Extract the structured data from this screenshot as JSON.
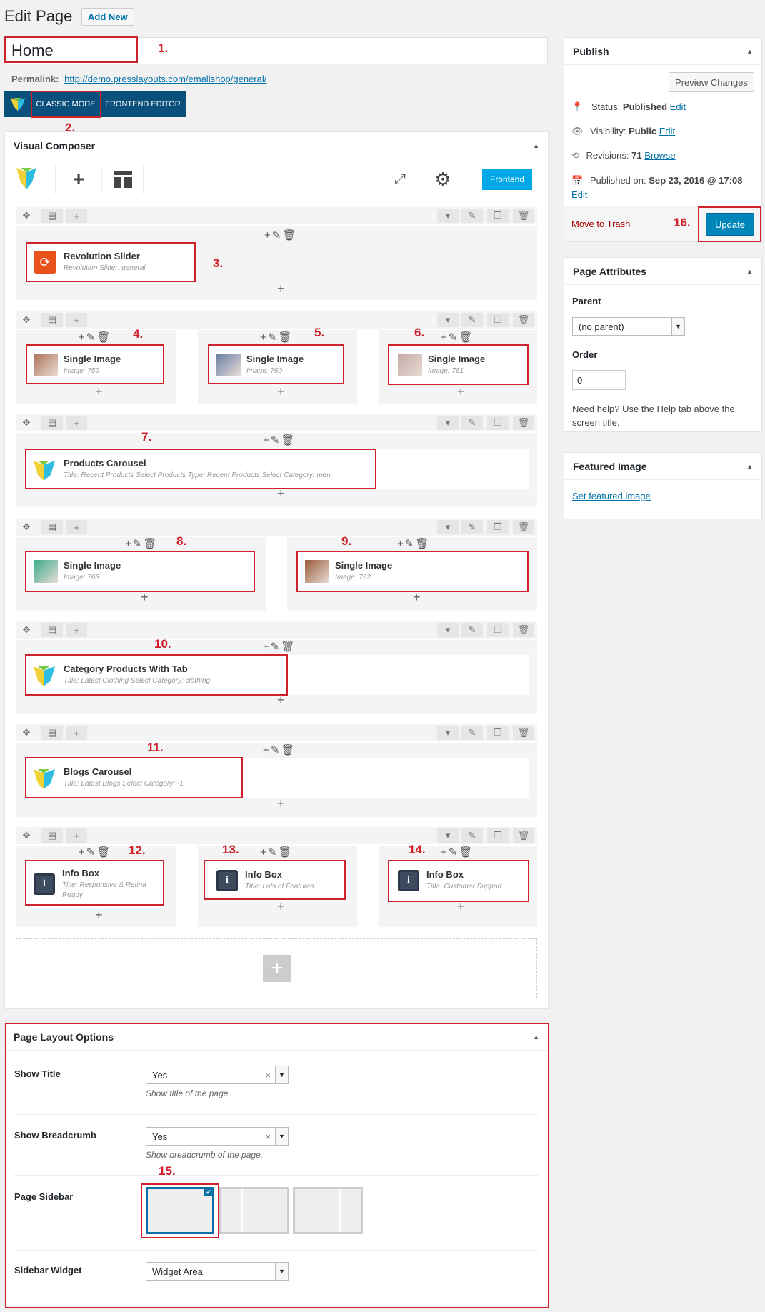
{
  "header": {
    "title": "Edit Page",
    "add_new": "Add New"
  },
  "title_field": {
    "value": "Home"
  },
  "permalink": {
    "label": "Permalink:",
    "url": "http://demo.presslayouts.com/emallshop/general/"
  },
  "modes": {
    "classic": "CLASSIC MODE",
    "frontend_editor": "FRONTEND EDITOR"
  },
  "annotations": [
    "1.",
    "2.",
    "3.",
    "4.",
    "5.",
    "6.",
    "7.",
    "8.",
    "9.",
    "10.",
    "11.",
    "12.",
    "13.",
    "14.",
    "15.",
    "16."
  ],
  "vc": {
    "title": "Visual Composer",
    "frontend_btn": "Frontend",
    "elements": [
      {
        "title": "Revolution Slider",
        "sub": "Revolution Slider: general"
      },
      {
        "title": "Single Image",
        "sub": "Image: 759"
      },
      {
        "title": "Single Image",
        "sub": "Image: 760"
      },
      {
        "title": "Single Image",
        "sub": "Image: 761"
      },
      {
        "title": "Products Carousel",
        "sub": "Title: Recent Products  Select Products Type: Recent Products  Select Category: men"
      },
      {
        "title": "Single Image",
        "sub": "Image: 763"
      },
      {
        "title": "Single Image",
        "sub": "Image: 762"
      },
      {
        "title": "Category Products With Tab",
        "sub": "Title: Latest Clothing  Select Category: clothing"
      },
      {
        "title": "Blogs Carousel",
        "sub": "Title: Latest Blogs  Select Category: -1"
      },
      {
        "title": "Info Box",
        "sub": "Title: Responsive & Retina Ready"
      },
      {
        "title": "Info Box",
        "sub": "Title: Lots of Features"
      },
      {
        "title": "Info Box",
        "sub": "Title: Customer Support"
      }
    ]
  },
  "publish": {
    "title": "Publish",
    "preview": "Preview Changes",
    "status_label": "Status:",
    "status_value": "Published",
    "status_edit": "Edit",
    "visibility_label": "Visibility:",
    "visibility_value": "Public",
    "visibility_edit": "Edit",
    "revisions_label": "Revisions:",
    "revisions_value": "71",
    "revisions_browse": "Browse",
    "published_label": "Published on:",
    "published_value": "Sep 23, 2016 @ 17:08",
    "published_edit": "Edit",
    "trash": "Move to Trash",
    "update": "Update"
  },
  "page_attributes": {
    "title": "Page Attributes",
    "parent_label": "Parent",
    "parent_value": "(no parent)",
    "order_label": "Order",
    "order_value": "0",
    "help": "Need help? Use the Help tab above the screen title."
  },
  "featured": {
    "title": "Featured Image",
    "link": "Set featured image"
  },
  "layout_options": {
    "title": "Page Layout Options",
    "show_title_label": "Show Title",
    "show_title_value": "Yes",
    "show_title_help": "Show title of the page.",
    "show_breadcrumb_label": "Show Breadcrumb",
    "show_breadcrumb_value": "Yes",
    "show_breadcrumb_help": "Show breadcrumb of the page.",
    "sidebar_label": "Page Sidebar",
    "widget_label": "Sidebar Widget",
    "widget_value": "Widget Area"
  },
  "colors": {
    "accent": "#0073aa",
    "annotation": "#d0202a",
    "vc_frontend": "#00a8e6",
    "update": "#0085ba"
  }
}
